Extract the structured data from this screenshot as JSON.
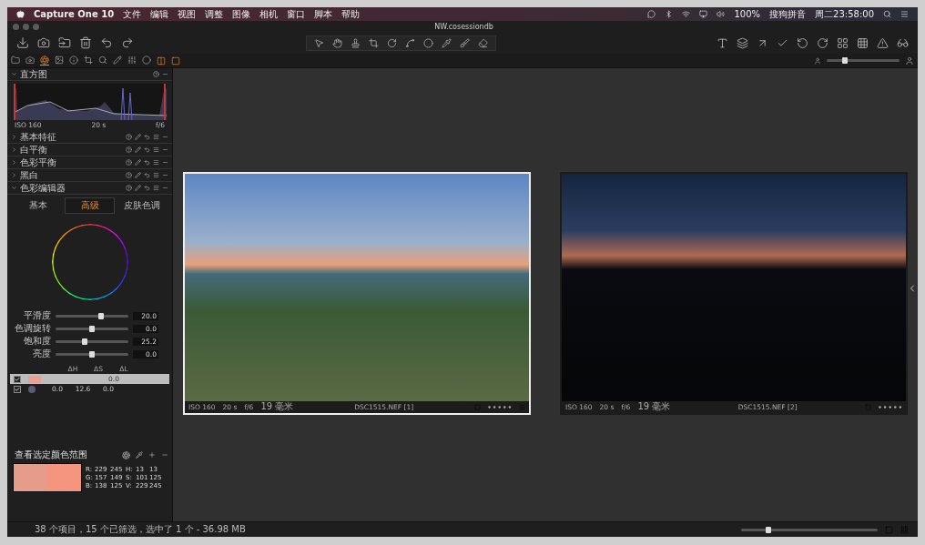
{
  "menubar": {
    "app": "Capture One 10",
    "menus": [
      "文件",
      "编辑",
      "视图",
      "调整",
      "图像",
      "相机",
      "窗口",
      "脚本",
      "帮助"
    ],
    "battery": "100%",
    "input_method": "搜狗拼音",
    "clock": "周二23:58:00"
  },
  "window": {
    "title": "NW.cosessiondb"
  },
  "tool_tabs": [
    {
      "selected": false
    },
    {
      "selected": false
    },
    {
      "selected": true
    },
    {
      "selected": false
    },
    {
      "selected": false
    },
    {
      "selected": false
    },
    {
      "selected": false
    },
    {
      "selected": false
    },
    {
      "selected": false
    },
    {
      "selected": false
    }
  ],
  "thumbnail_size": {
    "level": 0.25
  },
  "left_panel": {
    "histogram": {
      "title": "直方图",
      "expanded": true,
      "iso": "ISO 160",
      "shutter": "20 s",
      "aperture": "f/6"
    },
    "tools": [
      {
        "title": "基本特征",
        "expanded": false
      },
      {
        "title": "白平衡",
        "expanded": false
      },
      {
        "title": "色彩平衡",
        "expanded": false
      },
      {
        "title": "黑白",
        "expanded": false
      }
    ],
    "color_editor": {
      "title": "色彩编辑器",
      "expanded": true,
      "tabs": [
        {
          "label": "基本",
          "selected": false
        },
        {
          "label": "高级",
          "selected": true
        },
        {
          "label": "皮肤色调",
          "selected": false
        }
      ],
      "sliders": [
        {
          "label": "平滑度",
          "level": 0.62,
          "reading": "20.0"
        },
        {
          "label": "色调旋转",
          "level": 0.5,
          "reading": "0.0"
        },
        {
          "label": "饱和度",
          "level": 0.4,
          "reading": "25.2"
        },
        {
          "label": "亮度",
          "level": 0.5,
          "reading": "0.0"
        }
      ],
      "columns": [
        "ΔH",
        "ΔS",
        "ΔL"
      ],
      "ranges": [
        {
          "checked": true,
          "selected": true,
          "kind": "swatch",
          "color": "#e8a093",
          "values": [
            "0.0"
          ]
        },
        {
          "checked": true,
          "selected": false,
          "kind": "dot",
          "color": "#5c5c78",
          "values": [
            "0.0",
            "12.6",
            "0.0"
          ]
        }
      ],
      "picker": {
        "title": "查看选定颜色范围",
        "swatches": [
          {
            "color": "#e59d8a"
          },
          {
            "color": "#f5957d"
          }
        ],
        "readout": [
          [
            "R:",
            "229",
            "245",
            "H:",
            "13",
            "13"
          ],
          [
            "G:",
            "157",
            "149",
            "S:",
            "101",
            "125"
          ],
          [
            "B:",
            "138",
            "125",
            "V:",
            "229",
            "245"
          ]
        ]
      }
    }
  },
  "viewer": {
    "images": [
      {
        "selected": true,
        "kind": "dusk",
        "iso": "ISO 160",
        "shutter": "20 s",
        "aperture": "f/6",
        "focal": "19 毫米",
        "filename": "DSC1515.NEF [1]"
      },
      {
        "selected": false,
        "kind": "dark",
        "iso": "ISO 160",
        "shutter": "20 s",
        "aperture": "f/6",
        "focal": "19 毫米",
        "filename": "DSC1515.NEF [2]"
      }
    ]
  },
  "status_bar": {
    "text": "38 个项目，15 个已筛选，选中了 1 个 - 36.98 MB",
    "zoom": {
      "level": 0.2
    }
  }
}
